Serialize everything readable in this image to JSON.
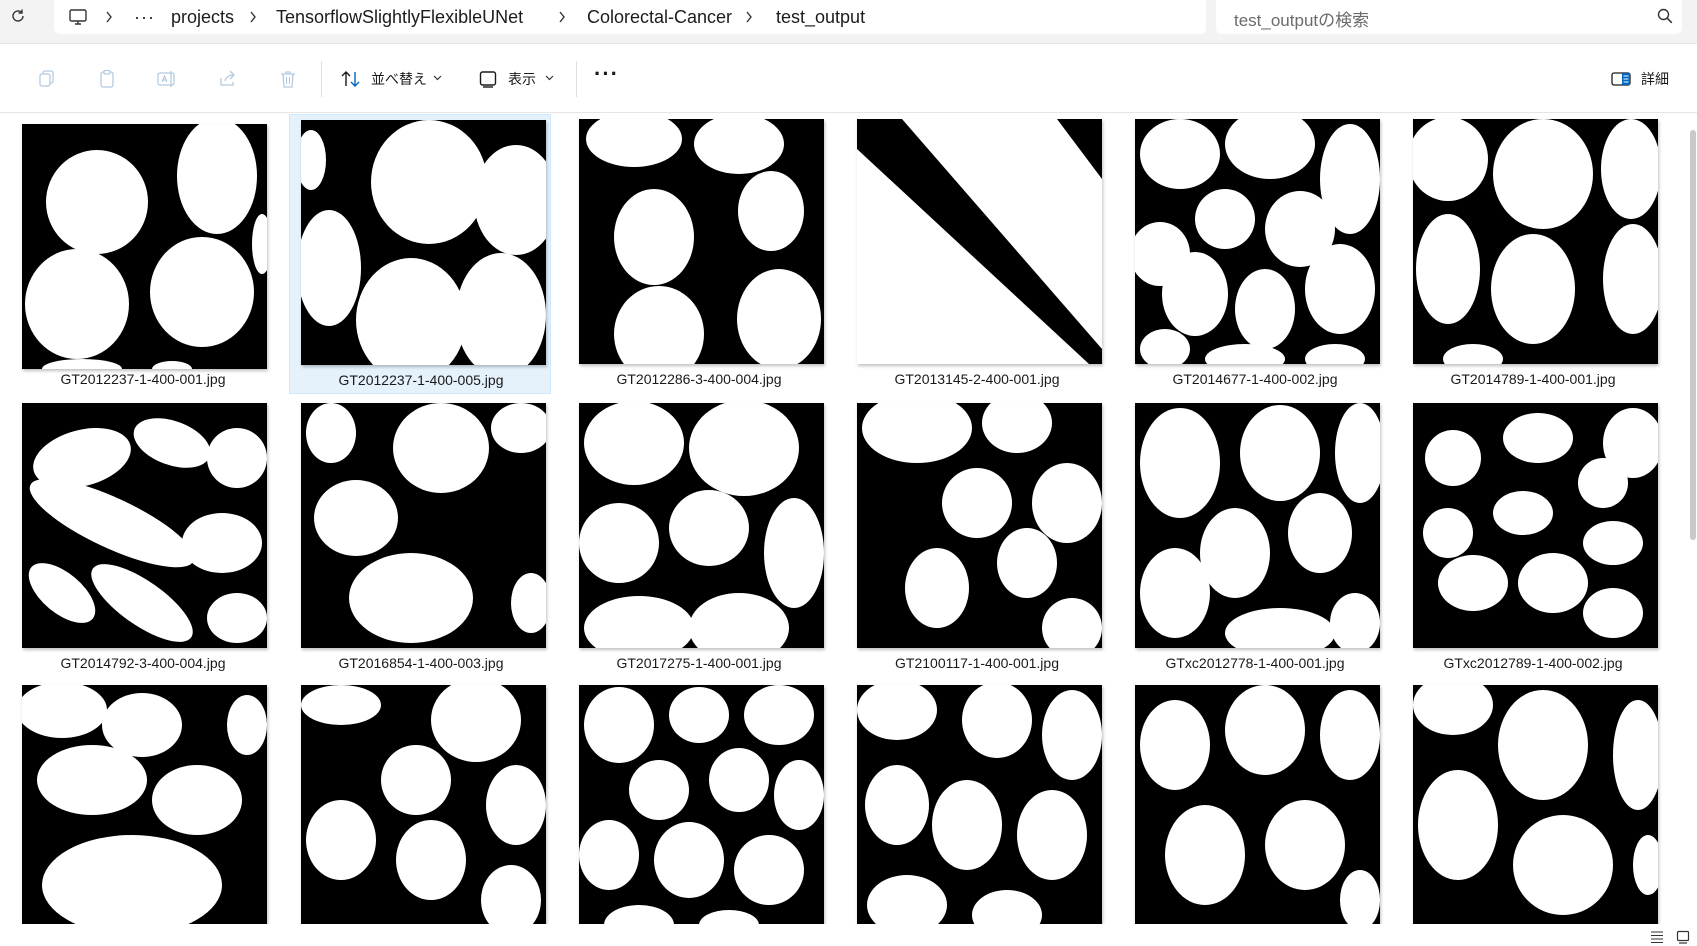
{
  "address": {
    "breadcrumbs": [
      "projects",
      "TensorflowSlightlyFlexibleUNet",
      "Colorectal-Cancer",
      "test_output"
    ],
    "overflow_label": "···",
    "search_placeholder": "test_outputの検索"
  },
  "toolbar": {
    "sort_label": "並べ替え",
    "view_label": "表示",
    "more_label": "···",
    "details_label": "詳細"
  },
  "files": [
    {
      "name": "GT2012237-1-400-001.jpg"
    },
    {
      "name": "GT2012237-1-400-005.jpg",
      "selected": true
    },
    {
      "name": "GT2012286-3-400-004.jpg"
    },
    {
      "name": "GT2013145-2-400-001.jpg"
    },
    {
      "name": "GT2014677-1-400-002.jpg"
    },
    {
      "name": "GT2014789-1-400-001.jpg"
    },
    {
      "name": "GT2014792-3-400-004.jpg"
    },
    {
      "name": "GT2016854-1-400-003.jpg"
    },
    {
      "name": "GT2017275-1-400-001.jpg"
    },
    {
      "name": "GT2100117-1-400-001.jpg"
    },
    {
      "name": "GTxc2012778-1-400-001.jpg"
    },
    {
      "name": "GTxc2012789-1-400-002.jpg"
    },
    {
      "name": ""
    },
    {
      "name": ""
    },
    {
      "name": ""
    },
    {
      "name": ""
    },
    {
      "name": ""
    },
    {
      "name": ""
    }
  ],
  "colors": {
    "selection_bg": "#e5f1fb",
    "accent": "#0067c0"
  }
}
